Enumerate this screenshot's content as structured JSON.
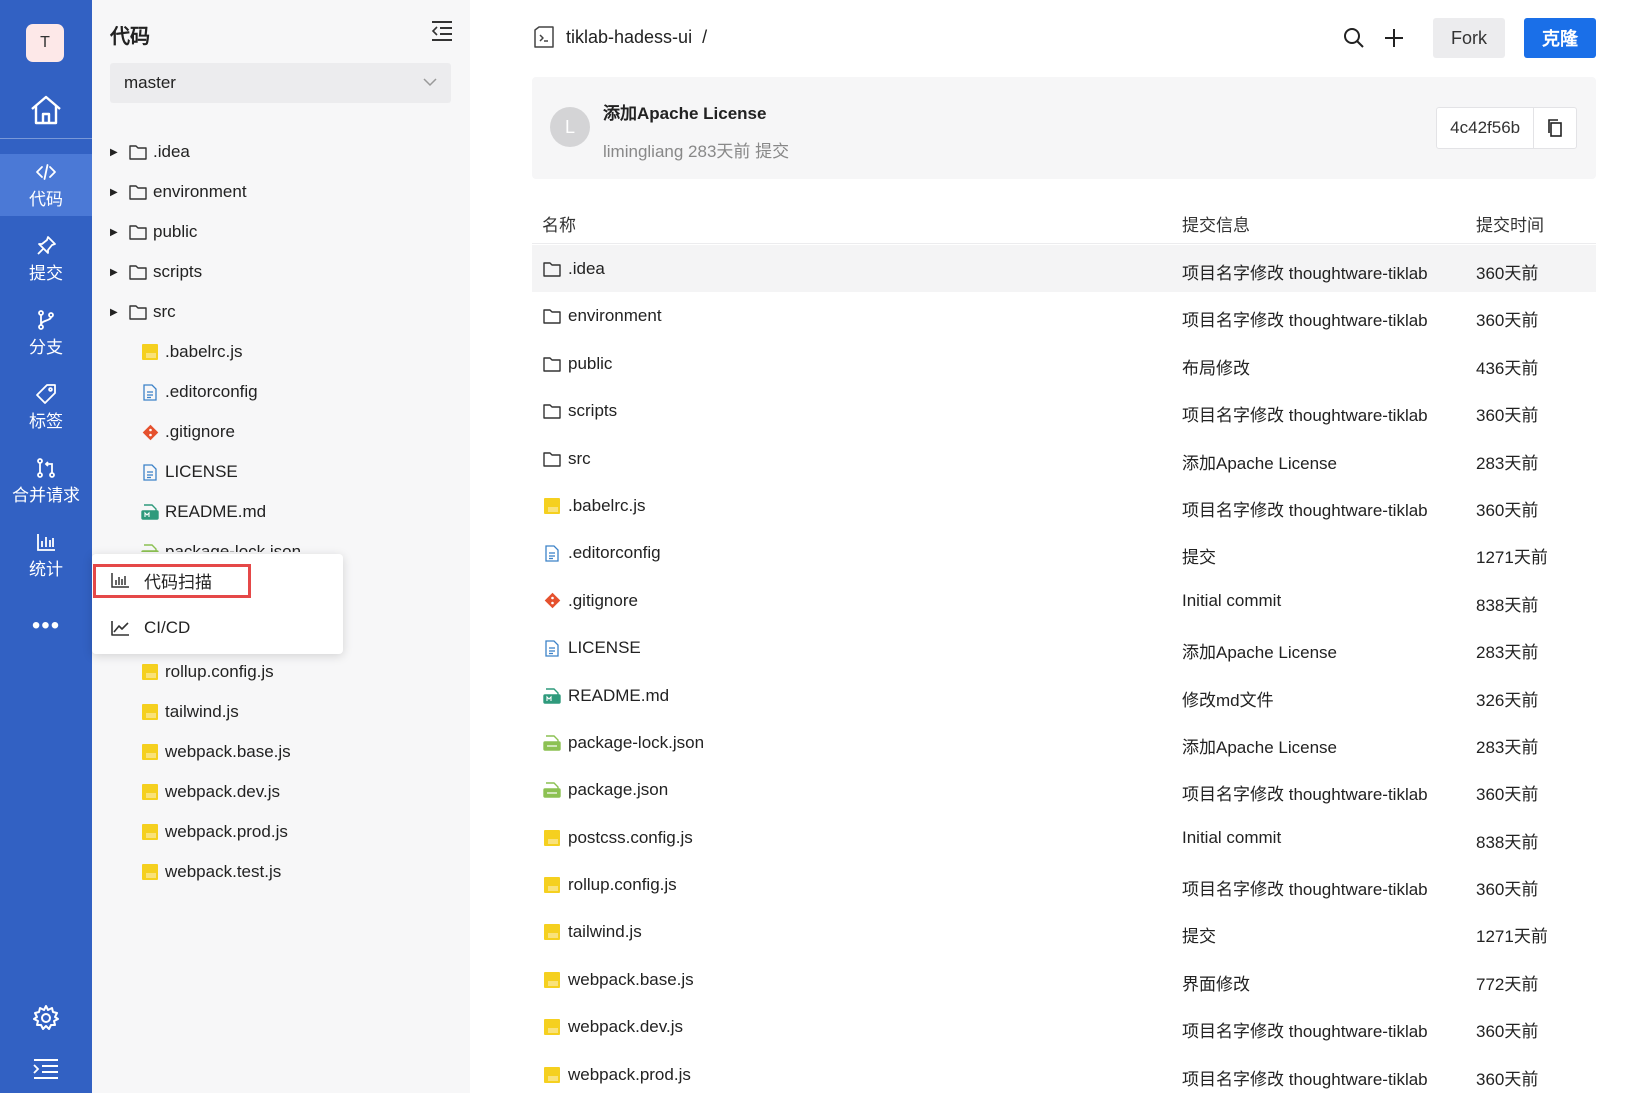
{
  "nav": {
    "avatar": "T",
    "items": [
      {
        "label": "代码",
        "icon": "code-icon"
      },
      {
        "label": "提交",
        "icon": "pin-icon"
      },
      {
        "label": "分支",
        "icon": "branch-icon"
      },
      {
        "label": "标签",
        "icon": "tag-icon"
      },
      {
        "label": "合并请求",
        "icon": "merge-request-icon"
      },
      {
        "label": "统计",
        "icon": "statistics-icon"
      }
    ],
    "more": "•••"
  },
  "tree": {
    "title": "代码",
    "branch": "master",
    "items": [
      {
        "name": ".idea",
        "type": "folder"
      },
      {
        "name": "environment",
        "type": "folder"
      },
      {
        "name": "public",
        "type": "folder"
      },
      {
        "name": "scripts",
        "type": "folder"
      },
      {
        "name": "src",
        "type": "folder"
      },
      {
        "name": ".babelrc.js",
        "type": "js"
      },
      {
        "name": ".editorconfig",
        "type": "config"
      },
      {
        "name": ".gitignore",
        "type": "git"
      },
      {
        "name": "LICENSE",
        "type": "config"
      },
      {
        "name": "README.md",
        "type": "md"
      },
      {
        "name": "package-lock.json",
        "type": "json"
      }
    ],
    "items_below": [
      {
        "name": "rollup.config.js",
        "type": "js"
      },
      {
        "name": "tailwind.js",
        "type": "js"
      },
      {
        "name": "webpack.base.js",
        "type": "js"
      },
      {
        "name": "webpack.dev.js",
        "type": "js"
      },
      {
        "name": "webpack.prod.js",
        "type": "js"
      },
      {
        "name": "webpack.test.js",
        "type": "js"
      }
    ]
  },
  "popup": {
    "items": [
      {
        "label": "代码扫描",
        "icon": "bar-chart-icon"
      },
      {
        "label": "CI/CD",
        "icon": "line-chart-icon"
      }
    ]
  },
  "header": {
    "repo": "tiklab-hadess-ui",
    "sep": "/",
    "fork_label": "Fork",
    "clone_label": "克隆"
  },
  "commit": {
    "avatar": "L",
    "title": "添加Apache License",
    "meta": "limingliang 283天前 提交",
    "hash": "4c42f56b"
  },
  "table": {
    "headers": {
      "name": "名称",
      "message": "提交信息",
      "time": "提交时间"
    },
    "rows": [
      {
        "name": ".idea",
        "type": "folder",
        "message": "项目名字修改 thoughtware-tiklab",
        "time": "360天前"
      },
      {
        "name": "environment",
        "type": "folder",
        "message": "项目名字修改 thoughtware-tiklab",
        "time": "360天前"
      },
      {
        "name": "public",
        "type": "folder",
        "message": "布局修改",
        "time": "436天前"
      },
      {
        "name": "scripts",
        "type": "folder",
        "message": "项目名字修改 thoughtware-tiklab",
        "time": "360天前"
      },
      {
        "name": "src",
        "type": "folder",
        "message": "添加Apache License",
        "time": "283天前"
      },
      {
        "name": ".babelrc.js",
        "type": "js",
        "message": "项目名字修改 thoughtware-tiklab",
        "time": "360天前"
      },
      {
        "name": ".editorconfig",
        "type": "config",
        "message": "提交",
        "time": "1271天前"
      },
      {
        "name": ".gitignore",
        "type": "git",
        "message": "Initial commit",
        "time": "838天前"
      },
      {
        "name": "LICENSE",
        "type": "config",
        "message": "添加Apache License",
        "time": "283天前"
      },
      {
        "name": "README.md",
        "type": "md",
        "message": "修改md文件",
        "time": "326天前"
      },
      {
        "name": "package-lock.json",
        "type": "json",
        "message": "添加Apache License",
        "time": "283天前"
      },
      {
        "name": "package.json",
        "type": "json",
        "message": "项目名字修改 thoughtware-tiklab",
        "time": "360天前"
      },
      {
        "name": "postcss.config.js",
        "type": "js",
        "message": "Initial commit",
        "time": "838天前"
      },
      {
        "name": "rollup.config.js",
        "type": "js",
        "message": "项目名字修改 thoughtware-tiklab",
        "time": "360天前"
      },
      {
        "name": "tailwind.js",
        "type": "js",
        "message": "提交",
        "time": "1271天前"
      },
      {
        "name": "webpack.base.js",
        "type": "js",
        "message": "界面修改",
        "time": "772天前"
      },
      {
        "name": "webpack.dev.js",
        "type": "js",
        "message": "项目名字修改 thoughtware-tiklab",
        "time": "360天前"
      },
      {
        "name": "webpack.prod.js",
        "type": "js",
        "message": "项目名字修改 thoughtware-tiklab",
        "time": "360天前"
      }
    ]
  }
}
